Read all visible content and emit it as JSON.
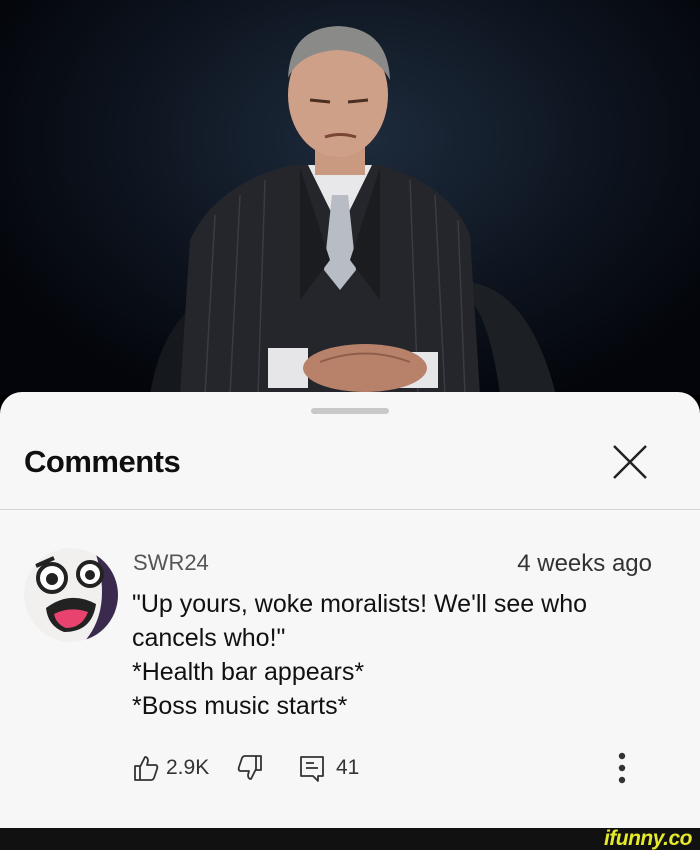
{
  "sheet": {
    "title": "Comments"
  },
  "comment": {
    "author": "SWR24",
    "time": "4 weeks ago",
    "lines": [
      "\"Up yours, woke moralists! We'll see who",
      "cancels who!\"",
      "*Health bar appears*",
      "*Boss music starts*"
    ],
    "likes": "2.9K",
    "replies": "41"
  },
  "watermark": "ifunny.co"
}
